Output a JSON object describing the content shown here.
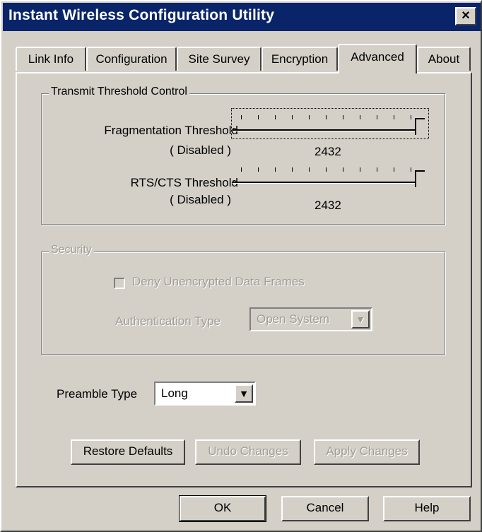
{
  "window": {
    "title": "Instant Wireless Configuration Utility",
    "close_glyph": "×"
  },
  "tabs": [
    {
      "label": "Link Info",
      "active": false
    },
    {
      "label": "Configuration",
      "active": false
    },
    {
      "label": "Site Survey",
      "active": false
    },
    {
      "label": "Encryption",
      "active": false
    },
    {
      "label": "Advanced",
      "active": true
    },
    {
      "label": "About",
      "active": false
    }
  ],
  "transmit": {
    "legend": "Transmit Threshold Control",
    "fragmentation": {
      "label": "Fragmentation Threshold",
      "state": "( Disabled )",
      "value": "2432"
    },
    "rts": {
      "label": "RTS/CTS Threshold",
      "state": "( Disabled )",
      "value": "2432"
    }
  },
  "security": {
    "legend": "Security",
    "deny_label": "Deny Unencrypted Data Frames",
    "deny_checked": false,
    "auth_label": "Authentication Type",
    "auth_value": "Open System"
  },
  "preamble": {
    "label": "Preamble Type",
    "value": "Long"
  },
  "panel_buttons": {
    "restore": "Restore Defaults",
    "undo": "Undo Changes",
    "apply": "Apply Changes"
  },
  "dialog_buttons": {
    "ok": "OK",
    "cancel": "Cancel",
    "help": "Help"
  },
  "icons": {
    "dropdown": "▼"
  }
}
